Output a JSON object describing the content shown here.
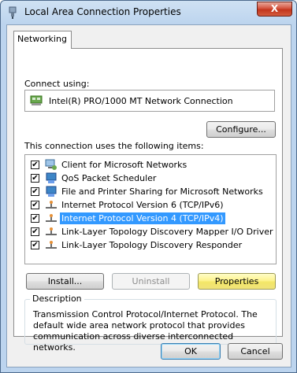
{
  "window": {
    "title": "Local Area Connection Properties",
    "close_label": "X"
  },
  "tabs": [
    {
      "label": "Networking"
    }
  ],
  "connect_using": {
    "label": "Connect using:",
    "adapter": "Intel(R) PRO/1000 MT Network Connection",
    "configure_label": "Configure..."
  },
  "items": {
    "label": "This connection uses the following items:",
    "list": [
      {
        "label": "Client for Microsoft Networks",
        "checked": true,
        "icon": "network-client-icon"
      },
      {
        "label": "QoS Packet Scheduler",
        "checked": true,
        "icon": "network-service-icon"
      },
      {
        "label": "File and Printer Sharing for Microsoft Networks",
        "checked": true,
        "icon": "network-service-icon"
      },
      {
        "label": "Internet Protocol Version 6 (TCP/IPv6)",
        "checked": true,
        "icon": "network-protocol-icon"
      },
      {
        "label": "Internet Protocol Version 4 (TCP/IPv4)",
        "checked": true,
        "icon": "network-protocol-icon",
        "selected": true
      },
      {
        "label": "Link-Layer Topology Discovery Mapper I/O Driver",
        "checked": true,
        "icon": "network-protocol-icon"
      },
      {
        "label": "Link-Layer Topology Discovery Responder",
        "checked": true,
        "icon": "network-protocol-icon"
      }
    ]
  },
  "buttons": {
    "install": "Install...",
    "uninstall": "Uninstall",
    "properties": "Properties"
  },
  "description": {
    "title": "Description",
    "text": "Transmission Control Protocol/Internet Protocol. The default wide area network protocol that provides communication across diverse interconnected networks."
  },
  "footer": {
    "ok": "OK",
    "cancel": "Cancel"
  },
  "colors": {
    "selection": "#3399ff",
    "hot_button": "#fdf38e",
    "close_button": "#c2351c"
  }
}
